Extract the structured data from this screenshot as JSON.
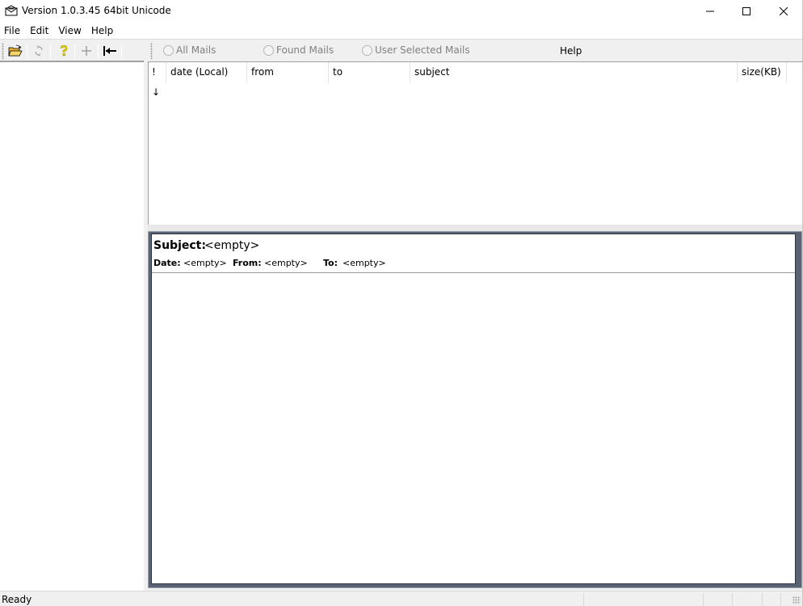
{
  "window": {
    "title": "Version 1.0.3.45 64bit Unicode"
  },
  "menu": {
    "items": [
      {
        "label": "File"
      },
      {
        "label": "Edit"
      },
      {
        "label": "View"
      },
      {
        "label": "Help"
      }
    ]
  },
  "toolbar": {
    "buttons": [
      {
        "icon": "open-folder-icon"
      },
      {
        "icon": "refresh-icon"
      },
      {
        "icon": "help-question-icon"
      },
      {
        "icon": "add-icon"
      },
      {
        "icon": "collapse-left-icon"
      }
    ]
  },
  "filter": {
    "options": [
      {
        "label": "All Mails"
      },
      {
        "label": "Found Mails"
      },
      {
        "label": "User Selected Mails"
      }
    ],
    "help_label": "Help"
  },
  "mail_list": {
    "columns": [
      {
        "label": "! ↓"
      },
      {
        "label": "date (Local)"
      },
      {
        "label": "from"
      },
      {
        "label": "to"
      },
      {
        "label": "subject"
      },
      {
        "label": "size(KB)"
      }
    ]
  },
  "preview": {
    "subject_label": "Subject:",
    "subject_value": "<empty>",
    "date_label": "Date:",
    "date_value": "<empty>",
    "from_label": "From:",
    "from_value": "<empty>",
    "to_label": "To:",
    "to_value": "<empty>"
  },
  "status": {
    "text": "Ready"
  },
  "colors": {
    "preview_frame": "#596373",
    "help_icon": "#e8d800",
    "folder_icon": "#e8b030"
  }
}
